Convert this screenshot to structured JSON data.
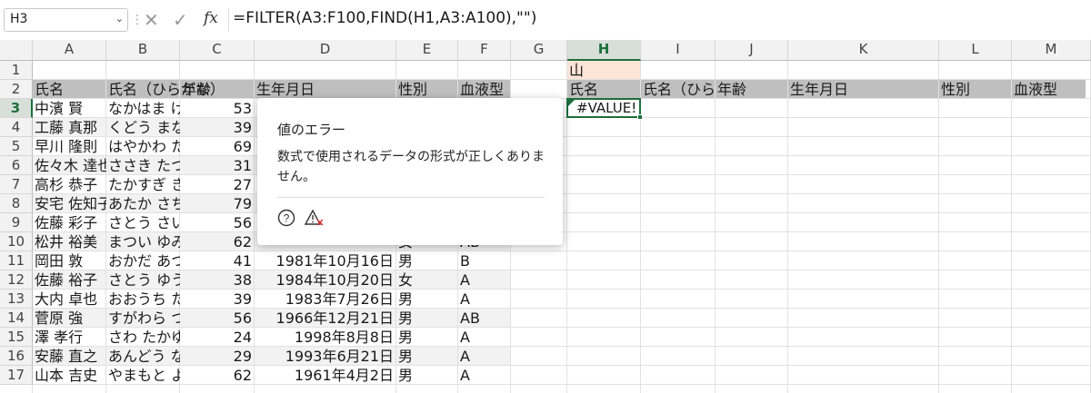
{
  "formula_bar": {
    "name_box": "H3",
    "formula": "=FILTER(A3:F100,FIND(H1,A3:A100),\"\")",
    "icons": [
      "chevron-down-icon",
      "cancel-icon",
      "enter-check-icon",
      "function-icon"
    ]
  },
  "columns": [
    "A",
    "B",
    "C",
    "D",
    "E",
    "F",
    "G",
    "H",
    "I",
    "J",
    "K",
    "L",
    "M"
  ],
  "rows": [
    "1",
    "2",
    "3",
    "4",
    "5",
    "6",
    "7",
    "8",
    "9",
    "10",
    "11",
    "12",
    "13",
    "14",
    "15",
    "16",
    "17"
  ],
  "cells": {
    "H1": "山",
    "H3": "#VALUE!"
  },
  "left_headers": [
    "氏名",
    "氏名（ひらがな）",
    "年齢",
    "生年月日",
    "性別",
    "血液型"
  ],
  "right_headers": [
    "氏名",
    "氏名（ひらがな）",
    "年齢",
    "生年月日",
    "性別",
    "血液型"
  ],
  "table_rows": [
    {
      "name": "中濱 賢",
      "kana": "なかはま けん",
      "age": "53",
      "dob": "",
      "sex": "",
      "blood": ""
    },
    {
      "name": "工藤 真那",
      "kana": "くどう まな",
      "age": "39",
      "dob": "",
      "sex": "",
      "blood": ""
    },
    {
      "name": "早川 隆則",
      "kana": "はやかわ たかのり",
      "age": "69",
      "dob": "",
      "sex": "",
      "blood": ""
    },
    {
      "name": "佐々木 達也",
      "kana": "ささき たつや",
      "age": "31",
      "dob": "",
      "sex": "",
      "blood": ""
    },
    {
      "name": "高杉 恭子",
      "kana": "たかすぎ きょうこ",
      "age": "27",
      "dob": "",
      "sex": "",
      "blood": ""
    },
    {
      "name": "安宅 佐知子",
      "kana": "あたか さちこ",
      "age": "79",
      "dob": "",
      "sex": "",
      "blood": ""
    },
    {
      "name": "佐藤 彩子",
      "kana": "さとう さいこ",
      "age": "56",
      "dob": "",
      "sex": "",
      "blood": ""
    },
    {
      "name": "松井 裕美",
      "kana": "まつい ゆみ",
      "age": "62",
      "dob": "",
      "sex": "女",
      "blood": "AB"
    },
    {
      "name": "岡田 敦",
      "kana": "おかだ あつし",
      "age": "41",
      "dob": "1981年10月16日",
      "sex": "男",
      "blood": "B"
    },
    {
      "name": "佐藤 裕子",
      "kana": "さとう ゆうこ",
      "age": "38",
      "dob": "1984年10月20日",
      "sex": "女",
      "blood": "A"
    },
    {
      "name": "大内 卓也",
      "kana": "おおうち たくや",
      "age": "39",
      "dob": "1983年7月26日",
      "sex": "男",
      "blood": "A"
    },
    {
      "name": "菅原 強",
      "kana": "すがわら つよし",
      "age": "56",
      "dob": "1966年12月21日",
      "sex": "男",
      "blood": "AB"
    },
    {
      "name": "澤 孝行",
      "kana": "さわ たかゆき",
      "age": "24",
      "dob": "1998年8月8日",
      "sex": "男",
      "blood": "A"
    },
    {
      "name": "安藤 直之",
      "kana": "あんどう なおゆき",
      "age": "29",
      "dob": "1993年6月21日",
      "sex": "男",
      "blood": "A"
    },
    {
      "name": "山本 吉史",
      "kana": "やまもと よしふみ",
      "age": "62",
      "dob": "1961年4月2日",
      "sex": "男",
      "blood": "A"
    }
  ],
  "error_popup": {
    "title": "値のエラー",
    "message": "数式で使用されるデータの形式が正しくありません。",
    "icons": [
      "help-icon",
      "trace-error-icon"
    ]
  },
  "colors": {
    "accent": "#1e6e3c",
    "header_band": "#bfbfbf",
    "row_band": "#f2f2f2",
    "search_cell": "#fce4d6"
  }
}
